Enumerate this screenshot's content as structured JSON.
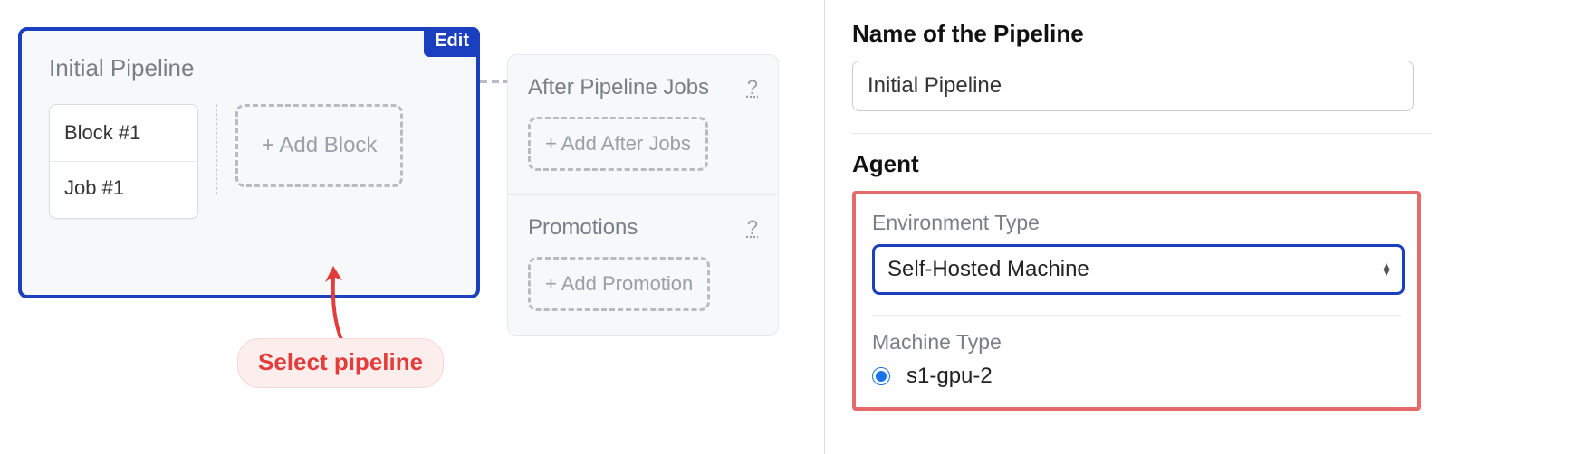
{
  "pipeline": {
    "title": "Initial Pipeline",
    "edit_badge": "Edit",
    "block": {
      "name": "Block #1",
      "job": "Job #1"
    },
    "add_block_label": "+ Add Block"
  },
  "side": {
    "after_jobs": {
      "title": "After Pipeline Jobs",
      "help": "?",
      "add_label": "+ Add After Jobs"
    },
    "promotions": {
      "title": "Promotions",
      "help": "?",
      "add_label": "+ Add Promotion"
    }
  },
  "callout": {
    "text": "Select pipeline"
  },
  "right": {
    "name_label": "Name of the Pipeline",
    "name_value": "Initial Pipeline",
    "agent_label": "Agent",
    "env_type_label": "Environment Type",
    "env_type_value": "Self-Hosted Machine",
    "machine_type_label": "Machine Type",
    "machine_type_value": "s1-gpu-2"
  },
  "colors": {
    "primary": "#1a3fbf",
    "danger": "#e43b3b",
    "danger_border": "#e76a6a"
  }
}
